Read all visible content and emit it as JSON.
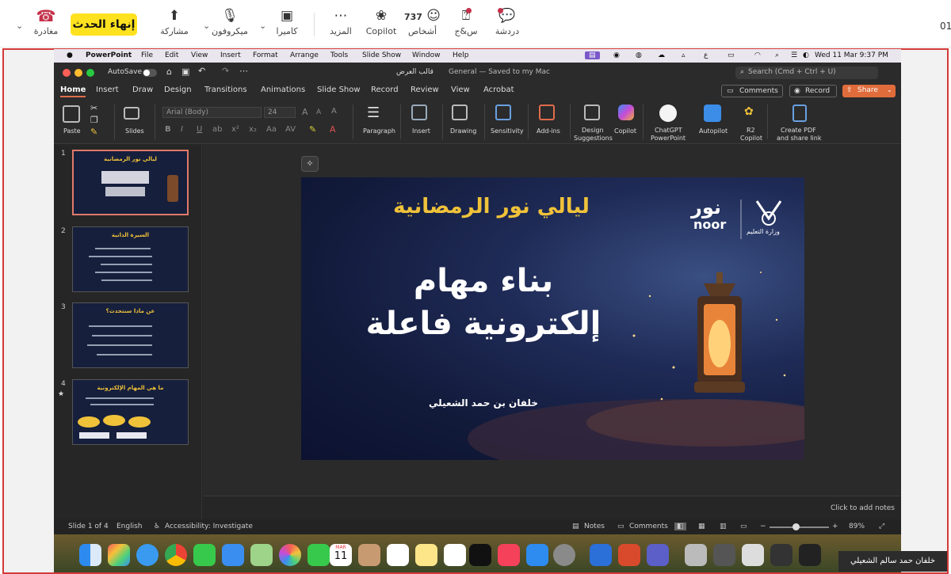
{
  "teams": {
    "leave_label": "مغادرة",
    "end_label": "إنهاء الحدث",
    "share_label": "مشاركة",
    "mic_label": "ميكروفون",
    "camera_label": "كاميرا",
    "more_label": "المزيد",
    "copilot_label": "Copilot",
    "people_label": "أشخاص",
    "people_count": "737",
    "qa_label": "س&ج",
    "chat_label": "دردشة",
    "time_partial": "01",
    "colors": {
      "end_bg": "#ffe21f",
      "leave_icon": "#c4314b"
    }
  },
  "mac_menu": {
    "app": "PowerPoint",
    "items": [
      "File",
      "Edit",
      "View",
      "Insert",
      "Format",
      "Arrange",
      "Tools",
      "Slide Show",
      "Window",
      "Help"
    ],
    "datetime": "Wed 11 Mar  9:37 PM"
  },
  "ppt": {
    "autosave": "AutoSave",
    "doc_title": "قالب العرض",
    "save_status": "General — Saved to my Mac",
    "search_placeholder": "Search (Cmd + Ctrl + U)",
    "tabs": [
      "Home",
      "Insert",
      "Draw",
      "Design",
      "Transitions",
      "Animations",
      "Slide Show",
      "Record",
      "Review",
      "View",
      "Acrobat"
    ],
    "comments_btn": "Comments",
    "record_btn": "Record",
    "share_btn": "Share",
    "ribbon": {
      "paste": "Paste",
      "slides": "Slides",
      "font_name": "Arial (Body)",
      "font_size": "24",
      "paragraph": "Paragraph",
      "insert": "Insert",
      "drawing": "Drawing",
      "sensitivity": "Sensitivity",
      "addins": "Add-ins",
      "design_suggestions_1": "Design",
      "design_suggestions_2": "Suggestions",
      "copilot": "Copilot",
      "chatgpt_1": "ChatGPT",
      "chatgpt_2": "PowerPoint",
      "autopilot": "Autopilot",
      "r2_1": "R2",
      "r2_2": "Copilot",
      "pdf_1": "Create PDF",
      "pdf_2": "and share link"
    },
    "thumbnails": [
      {
        "num": "1",
        "title": "ليالي نور الرمضانية"
      },
      {
        "num": "2",
        "title": "السيرة الذاتية"
      },
      {
        "num": "3",
        "title": "عن ماذا سنتحدث؟"
      },
      {
        "num": "4",
        "title": "ما هي المهام الإلكترونية"
      }
    ],
    "slide": {
      "header": "ليالي نور الرمضانية",
      "title_line1": "بناء مهام",
      "title_line2": "إلكترونية فاعلة",
      "presenter": "خلفان بن حمد الشعيلي",
      "logo_noor_ar": "نور",
      "logo_noor_en": "noor",
      "ministry": "وزارة التعليم"
    },
    "notes_placeholder": "Click to add notes",
    "status": {
      "slide_of": "Slide 1 of 4",
      "language": "English",
      "accessibility": "Accessibility: Investigate",
      "notes": "Notes",
      "comments": "Comments",
      "zoom": "89%"
    }
  },
  "presenter_name": "خلفان حمد سالم الشعيلي",
  "dock_calendar": {
    "month": "MAR",
    "day": "11"
  }
}
